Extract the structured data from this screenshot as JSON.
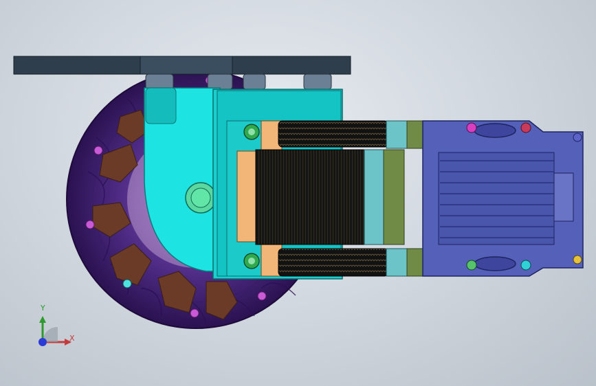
{
  "viewport": {
    "background": "#d6dce2",
    "model": "motor-wheel-assembly",
    "colors": {
      "plate": "#2d3d4c",
      "bracket": "#18d6d6",
      "motor_body": "#5560b8",
      "coil_pack": "#f2b679",
      "winding": "#141414",
      "ring_teal": "#6cc4c8",
      "ring_green": "#6f8b45",
      "wheel": "#4b2a7a",
      "wheel_mounts": "#6b3b28"
    }
  },
  "triad": {
    "y_label": "Y",
    "x_label": "X",
    "y_color": "#2e9a2e",
    "x_color": "#c43b3b",
    "z_color": "#2b3bd6"
  }
}
